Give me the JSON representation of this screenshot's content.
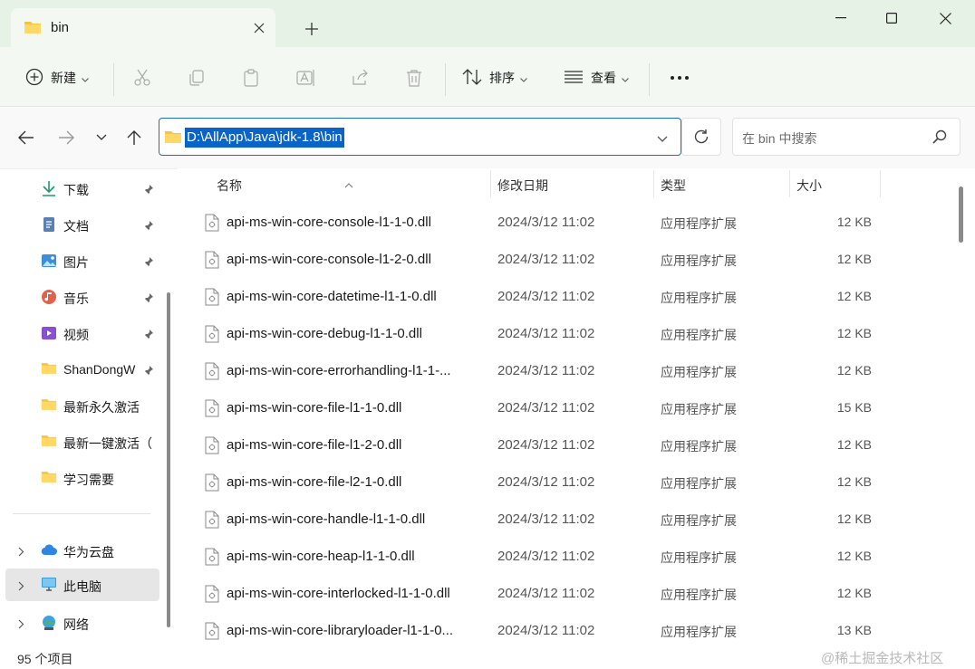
{
  "tab": {
    "title": "bin"
  },
  "toolbar": {
    "new_label": "新建",
    "sort_label": "排序",
    "view_label": "查看"
  },
  "address": {
    "path": "D:\\AllApp\\Java\\jdk-1.8\\bin"
  },
  "search": {
    "placeholder": "在 bin 中搜索"
  },
  "sidebar": {
    "quick": [
      {
        "label": "下载",
        "icon": "download-icon"
      },
      {
        "label": "文档",
        "icon": "documents-icon"
      },
      {
        "label": "图片",
        "icon": "pictures-icon"
      },
      {
        "label": "音乐",
        "icon": "music-icon"
      },
      {
        "label": "视频",
        "icon": "videos-icon"
      },
      {
        "label": "ShanDongW",
        "icon": "folder-icon"
      },
      {
        "label": "最新永久激活",
        "icon": "folder-icon"
      },
      {
        "label": "最新一键激活（",
        "icon": "folder-icon"
      },
      {
        "label": "学习需要",
        "icon": "folder-icon"
      }
    ],
    "locations": [
      {
        "label": "华为云盘",
        "icon": "cloud-icon"
      },
      {
        "label": "此电脑",
        "icon": "this-pc-icon"
      },
      {
        "label": "网络",
        "icon": "network-icon"
      }
    ]
  },
  "columns": {
    "name": "名称",
    "date": "修改日期",
    "type": "类型",
    "size": "大小"
  },
  "files": [
    {
      "name": "api-ms-win-core-console-l1-1-0.dll",
      "date": "2024/3/12 11:02",
      "type": "应用程序扩展",
      "size": "12 KB"
    },
    {
      "name": "api-ms-win-core-console-l1-2-0.dll",
      "date": "2024/3/12 11:02",
      "type": "应用程序扩展",
      "size": "12 KB"
    },
    {
      "name": "api-ms-win-core-datetime-l1-1-0.dll",
      "date": "2024/3/12 11:02",
      "type": "应用程序扩展",
      "size": "12 KB"
    },
    {
      "name": "api-ms-win-core-debug-l1-1-0.dll",
      "date": "2024/3/12 11:02",
      "type": "应用程序扩展",
      "size": "12 KB"
    },
    {
      "name": "api-ms-win-core-errorhandling-l1-1-...",
      "date": "2024/3/12 11:02",
      "type": "应用程序扩展",
      "size": "12 KB"
    },
    {
      "name": "api-ms-win-core-file-l1-1-0.dll",
      "date": "2024/3/12 11:02",
      "type": "应用程序扩展",
      "size": "15 KB"
    },
    {
      "name": "api-ms-win-core-file-l1-2-0.dll",
      "date": "2024/3/12 11:02",
      "type": "应用程序扩展",
      "size": "12 KB"
    },
    {
      "name": "api-ms-win-core-file-l2-1-0.dll",
      "date": "2024/3/12 11:02",
      "type": "应用程序扩展",
      "size": "12 KB"
    },
    {
      "name": "api-ms-win-core-handle-l1-1-0.dll",
      "date": "2024/3/12 11:02",
      "type": "应用程序扩展",
      "size": "12 KB"
    },
    {
      "name": "api-ms-win-core-heap-l1-1-0.dll",
      "date": "2024/3/12 11:02",
      "type": "应用程序扩展",
      "size": "12 KB"
    },
    {
      "name": "api-ms-win-core-interlocked-l1-1-0.dll",
      "date": "2024/3/12 11:02",
      "type": "应用程序扩展",
      "size": "12 KB"
    },
    {
      "name": "api-ms-win-core-libraryloader-l1-1-0...",
      "date": "2024/3/12 11:02",
      "type": "应用程序扩展",
      "size": "13 KB"
    }
  ],
  "status": {
    "count": "95 个项目"
  },
  "watermark": "@稀土掘金技术社区",
  "colors": {
    "accent": "#0a64c8",
    "titlebar": "#e7f2e6",
    "commandbar": "#f3f9f2"
  }
}
